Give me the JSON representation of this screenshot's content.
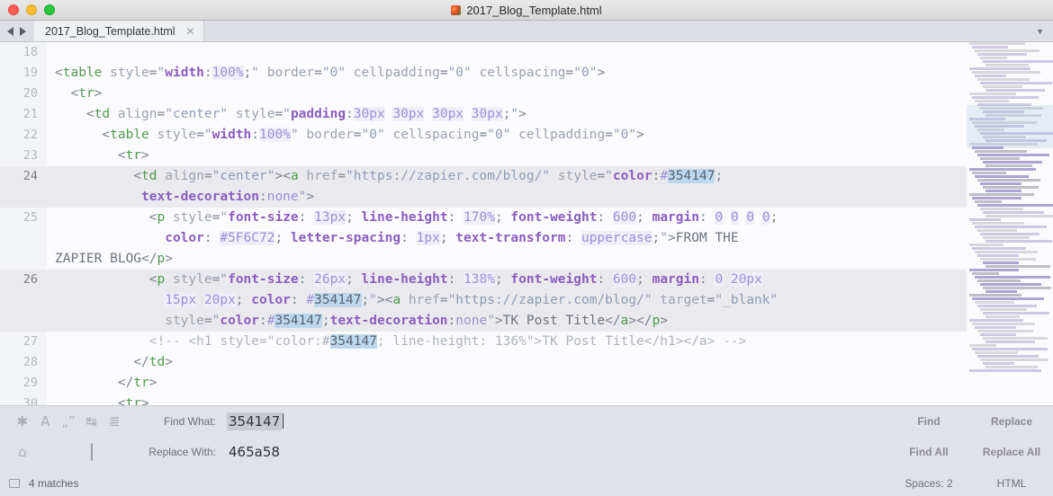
{
  "window": {
    "title": "2017_Blog_Template.html",
    "title_icon": "sublime-text-icon",
    "traffic_lights": [
      "close",
      "minimize",
      "zoom"
    ]
  },
  "tabbar": {
    "nav_back": "back-arrow",
    "nav_forward": "forward-arrow",
    "tabs": [
      {
        "label": "2017_Blog_Template.html",
        "close": "✕",
        "active": true
      }
    ],
    "menu_glyph": "▼"
  },
  "editor": {
    "lines": [
      {
        "num": "18",
        "highlight": false,
        "partial": true,
        "tokens": []
      },
      {
        "num": "19",
        "highlight": false,
        "tokens": [
          {
            "t": "punct",
            "v": "<"
          },
          {
            "t": "tag",
            "v": "table"
          },
          {
            "t": "attr",
            "v": " style"
          },
          {
            "t": "punct",
            "v": "="
          },
          {
            "t": "str",
            "v": "\""
          },
          {
            "t": "cssprop",
            "v": "width"
          },
          {
            "t": "punct",
            "v": ":"
          },
          {
            "t": "cssval",
            "v": "100%"
          },
          {
            "t": "punct",
            "v": ";"
          },
          {
            "t": "str",
            "v": "\""
          },
          {
            "t": "attr",
            "v": " border"
          },
          {
            "t": "punct",
            "v": "="
          },
          {
            "t": "str",
            "v": "\"0\""
          },
          {
            "t": "attr",
            "v": " cellpadding"
          },
          {
            "t": "punct",
            "v": "="
          },
          {
            "t": "str",
            "v": "\"0\""
          },
          {
            "t": "attr",
            "v": " cellspacing"
          },
          {
            "t": "punct",
            "v": "="
          },
          {
            "t": "str",
            "v": "\"0\""
          },
          {
            "t": "punct",
            "v": ">"
          }
        ]
      },
      {
        "num": "20",
        "highlight": false,
        "indent": 2,
        "tokens": [
          {
            "t": "punct",
            "v": "<"
          },
          {
            "t": "tag",
            "v": "tr"
          },
          {
            "t": "punct",
            "v": ">"
          }
        ]
      },
      {
        "num": "21",
        "highlight": false,
        "indent": 4,
        "tokens": [
          {
            "t": "punct",
            "v": "<"
          },
          {
            "t": "tag",
            "v": "td"
          },
          {
            "t": "attr",
            "v": " align"
          },
          {
            "t": "punct",
            "v": "="
          },
          {
            "t": "str",
            "v": "\"center\""
          },
          {
            "t": "attr",
            "v": " style"
          },
          {
            "t": "punct",
            "v": "="
          },
          {
            "t": "str",
            "v": "\""
          },
          {
            "t": "cssprop",
            "v": "padding"
          },
          {
            "t": "punct",
            "v": ":"
          },
          {
            "t": "cssval",
            "v": "30px"
          },
          {
            "t": "cssval-plain",
            "v": " "
          },
          {
            "t": "cssval",
            "v": "30px"
          },
          {
            "t": "cssval-plain",
            "v": " "
          },
          {
            "t": "cssval",
            "v": "30px"
          },
          {
            "t": "cssval-plain",
            "v": " "
          },
          {
            "t": "cssval",
            "v": "30px"
          },
          {
            "t": "punct",
            "v": ";"
          },
          {
            "t": "str",
            "v": "\""
          },
          {
            "t": "punct",
            "v": ">"
          }
        ]
      },
      {
        "num": "22",
        "highlight": false,
        "indent": 6,
        "tokens": [
          {
            "t": "punct",
            "v": "<"
          },
          {
            "t": "tag",
            "v": "table"
          },
          {
            "t": "attr",
            "v": " style"
          },
          {
            "t": "punct",
            "v": "="
          },
          {
            "t": "str",
            "v": "\""
          },
          {
            "t": "cssprop",
            "v": "width"
          },
          {
            "t": "punct",
            "v": ":"
          },
          {
            "t": "cssval",
            "v": "100%"
          },
          {
            "t": "str",
            "v": "\""
          },
          {
            "t": "attr",
            "v": " border"
          },
          {
            "t": "punct",
            "v": "="
          },
          {
            "t": "str",
            "v": "\"0\""
          },
          {
            "t": "attr",
            "v": " cellspacing"
          },
          {
            "t": "punct",
            "v": "="
          },
          {
            "t": "str",
            "v": "\"0\""
          },
          {
            "t": "attr",
            "v": " cellpadding"
          },
          {
            "t": "punct",
            "v": "="
          },
          {
            "t": "str",
            "v": "\"0\""
          },
          {
            "t": "punct",
            "v": ">"
          }
        ]
      },
      {
        "num": "23",
        "highlight": false,
        "indent": 8,
        "tokens": [
          {
            "t": "punct",
            "v": "<"
          },
          {
            "t": "tag",
            "v": "tr"
          },
          {
            "t": "punct",
            "v": ">"
          }
        ]
      },
      {
        "num": "24",
        "highlight": true,
        "indent": 10,
        "tokens": [
          {
            "t": "punct",
            "v": "<"
          },
          {
            "t": "tag",
            "v": "td"
          },
          {
            "t": "attr",
            "v": " align"
          },
          {
            "t": "punct",
            "v": "="
          },
          {
            "t": "str",
            "v": "\"center\""
          },
          {
            "t": "punct",
            "v": ">"
          },
          {
            "t": "punct",
            "v": "<"
          },
          {
            "t": "tag",
            "v": "a"
          },
          {
            "t": "attr",
            "v": " href"
          },
          {
            "t": "punct",
            "v": "="
          },
          {
            "t": "str",
            "v": "\"https://zapier.com/blog/\""
          },
          {
            "t": "attr",
            "v": " style"
          },
          {
            "t": "punct",
            "v": "="
          },
          {
            "t": "str",
            "v": "\""
          },
          {
            "t": "cssprop",
            "v": "color"
          },
          {
            "t": "punct",
            "v": ":"
          },
          {
            "t": "cssval-plain",
            "v": "#"
          },
          {
            "t": "sel",
            "v": "354147"
          },
          {
            "t": "punct",
            "v": ";"
          }
        ]
      },
      {
        "num": "",
        "highlight": true,
        "indent": 11,
        "wrap": true,
        "tokens": [
          {
            "t": "cssprop",
            "v": "text-decoration"
          },
          {
            "t": "punct",
            "v": ":"
          },
          {
            "t": "cssval-plain",
            "v": "none"
          },
          {
            "t": "str",
            "v": "\""
          },
          {
            "t": "punct",
            "v": ">"
          }
        ]
      },
      {
        "num": "25",
        "highlight": false,
        "indent": 12,
        "tokens": [
          {
            "t": "punct",
            "v": "<"
          },
          {
            "t": "tag",
            "v": "p"
          },
          {
            "t": "attr",
            "v": " style"
          },
          {
            "t": "punct",
            "v": "="
          },
          {
            "t": "str",
            "v": "\""
          },
          {
            "t": "cssprop",
            "v": "font-size"
          },
          {
            "t": "punct",
            "v": ": "
          },
          {
            "t": "cssval",
            "v": "13px"
          },
          {
            "t": "punct",
            "v": "; "
          },
          {
            "t": "cssprop",
            "v": "line-height"
          },
          {
            "t": "punct",
            "v": ": "
          },
          {
            "t": "cssval",
            "v": "170%"
          },
          {
            "t": "punct",
            "v": "; "
          },
          {
            "t": "cssprop",
            "v": "font-weight"
          },
          {
            "t": "punct",
            "v": ": "
          },
          {
            "t": "cssval",
            "v": "600"
          },
          {
            "t": "punct",
            "v": "; "
          },
          {
            "t": "cssprop",
            "v": "margin"
          },
          {
            "t": "punct",
            "v": ": "
          },
          {
            "t": "cssval",
            "v": "0"
          },
          {
            "t": "cssval-plain",
            "v": " "
          },
          {
            "t": "cssval",
            "v": "0"
          },
          {
            "t": "cssval-plain",
            "v": " "
          },
          {
            "t": "cssval",
            "v": "0"
          },
          {
            "t": "cssval-plain",
            "v": " "
          },
          {
            "t": "cssval",
            "v": "0"
          },
          {
            "t": "punct",
            "v": ";"
          }
        ]
      },
      {
        "num": "",
        "highlight": false,
        "indent": 14,
        "wrap": true,
        "tokens": [
          {
            "t": "cssprop",
            "v": "color"
          },
          {
            "t": "punct",
            "v": ": "
          },
          {
            "t": "cssval",
            "v": "#5F6C72"
          },
          {
            "t": "punct",
            "v": "; "
          },
          {
            "t": "cssprop",
            "v": "letter-spacing"
          },
          {
            "t": "punct",
            "v": ": "
          },
          {
            "t": "cssval",
            "v": "1px"
          },
          {
            "t": "punct",
            "v": "; "
          },
          {
            "t": "cssprop",
            "v": "text-transform"
          },
          {
            "t": "punct",
            "v": ": "
          },
          {
            "t": "cssval",
            "v": "uppercase"
          },
          {
            "t": "punct",
            "v": ";"
          },
          {
            "t": "str",
            "v": "\""
          },
          {
            "t": "punct",
            "v": ">"
          },
          {
            "t": "txt",
            "v": "FROM THE"
          }
        ]
      },
      {
        "num": "",
        "highlight": false,
        "indent": 0,
        "wrap": true,
        "tokens": [
          {
            "t": "txt",
            "v": "ZAPIER BLOG"
          },
          {
            "t": "punct",
            "v": "</"
          },
          {
            "t": "tag",
            "v": "p"
          },
          {
            "t": "punct",
            "v": ">"
          }
        ]
      },
      {
        "num": "26",
        "highlight": true,
        "indent": 12,
        "tokens": [
          {
            "t": "punct",
            "v": "<"
          },
          {
            "t": "tag",
            "v": "p"
          },
          {
            "t": "attr",
            "v": " style"
          },
          {
            "t": "punct",
            "v": "="
          },
          {
            "t": "str",
            "v": "\""
          },
          {
            "t": "cssprop",
            "v": "font-size"
          },
          {
            "t": "punct",
            "v": ": "
          },
          {
            "t": "cssval",
            "v": "26px"
          },
          {
            "t": "punct",
            "v": "; "
          },
          {
            "t": "cssprop",
            "v": "line-height"
          },
          {
            "t": "punct",
            "v": ": "
          },
          {
            "t": "cssval",
            "v": "138%"
          },
          {
            "t": "punct",
            "v": "; "
          },
          {
            "t": "cssprop",
            "v": "font-weight"
          },
          {
            "t": "punct",
            "v": ": "
          },
          {
            "t": "cssval",
            "v": "600"
          },
          {
            "t": "punct",
            "v": "; "
          },
          {
            "t": "cssprop",
            "v": "margin"
          },
          {
            "t": "punct",
            "v": ": "
          },
          {
            "t": "cssval",
            "v": "0"
          },
          {
            "t": "cssval-plain",
            "v": " "
          },
          {
            "t": "cssval",
            "v": "20px"
          }
        ]
      },
      {
        "num": "",
        "highlight": true,
        "indent": 14,
        "wrap": true,
        "tokens": [
          {
            "t": "cssval",
            "v": "15px"
          },
          {
            "t": "cssval-plain",
            "v": " "
          },
          {
            "t": "cssval",
            "v": "20px"
          },
          {
            "t": "punct",
            "v": "; "
          },
          {
            "t": "cssprop",
            "v": "color"
          },
          {
            "t": "punct",
            "v": ": "
          },
          {
            "t": "cssval-plain",
            "v": "#"
          },
          {
            "t": "sel",
            "v": "354147"
          },
          {
            "t": "punct",
            "v": ";"
          },
          {
            "t": "str",
            "v": "\""
          },
          {
            "t": "punct",
            "v": ">"
          },
          {
            "t": "punct",
            "v": "<"
          },
          {
            "t": "tag",
            "v": "a"
          },
          {
            "t": "attr",
            "v": " href"
          },
          {
            "t": "punct",
            "v": "="
          },
          {
            "t": "str",
            "v": "\"https://zapier.com/blog/\""
          },
          {
            "t": "attr",
            "v": " target"
          },
          {
            "t": "punct",
            "v": "="
          },
          {
            "t": "str",
            "v": "\"_blank\""
          }
        ]
      },
      {
        "num": "",
        "highlight": true,
        "indent": 14,
        "wrap": true,
        "tokens": [
          {
            "t": "attr",
            "v": "style"
          },
          {
            "t": "punct",
            "v": "="
          },
          {
            "t": "str",
            "v": "\""
          },
          {
            "t": "cssprop",
            "v": "color"
          },
          {
            "t": "punct",
            "v": ":"
          },
          {
            "t": "cssval-plain",
            "v": "#"
          },
          {
            "t": "sel",
            "v": "354147"
          },
          {
            "t": "punct",
            "v": ";"
          },
          {
            "t": "cssprop",
            "v": "text-decoration"
          },
          {
            "t": "punct",
            "v": ":"
          },
          {
            "t": "cssval-plain",
            "v": "none"
          },
          {
            "t": "str",
            "v": "\""
          },
          {
            "t": "punct",
            "v": ">"
          },
          {
            "t": "txt",
            "v": "TK Post Title"
          },
          {
            "t": "punct",
            "v": "</"
          },
          {
            "t": "tag",
            "v": "a"
          },
          {
            "t": "punct",
            "v": ">"
          },
          {
            "t": "punct",
            "v": "</"
          },
          {
            "t": "tag",
            "v": "p"
          },
          {
            "t": "punct",
            "v": ">"
          }
        ]
      },
      {
        "num": "27",
        "highlight": false,
        "indent": 12,
        "tokens": [
          {
            "t": "comment",
            "v": "<!-- <h1 style=\"color:#"
          },
          {
            "t": "sel",
            "v": "354147"
          },
          {
            "t": "comment",
            "v": "; line-height: 136%\">TK Post Title</h1></a> -->"
          }
        ]
      },
      {
        "num": "28",
        "highlight": false,
        "indent": 10,
        "tokens": [
          {
            "t": "punct",
            "v": "</"
          },
          {
            "t": "tag",
            "v": "td"
          },
          {
            "t": "punct",
            "v": ">"
          }
        ]
      },
      {
        "num": "29",
        "highlight": false,
        "indent": 8,
        "tokens": [
          {
            "t": "punct",
            "v": "</"
          },
          {
            "t": "tag",
            "v": "tr"
          },
          {
            "t": "punct",
            "v": ">"
          }
        ]
      },
      {
        "num": "30",
        "highlight": false,
        "indent": 8,
        "tokens": [
          {
            "t": "punct",
            "v": "<"
          },
          {
            "t": "tag",
            "v": "tr"
          },
          {
            "t": "punct",
            "v": ">"
          }
        ]
      }
    ]
  },
  "find_panel": {
    "toggles_row1": [
      {
        "name": "regex-toggle",
        "glyph": "✱"
      },
      {
        "name": "case-sensitive-toggle",
        "glyph": "A"
      },
      {
        "name": "whole-word-toggle",
        "glyph": "„”"
      },
      {
        "name": "wrap-toggle",
        "glyph": "↹"
      },
      {
        "name": "in-selection-toggle",
        "glyph": "≣"
      }
    ],
    "toggles_row2": [
      {
        "name": "preserve-case-toggle",
        "glyph": "⌂"
      },
      {
        "name": "highlight-matches-checkbox",
        "glyph": "checkbox"
      }
    ],
    "find_label": "Find What:",
    "find_value": "354147",
    "replace_label": "Replace With:",
    "replace_value": "465a58",
    "buttons": {
      "find": "Find",
      "replace": "Replace",
      "find_all": "Find All",
      "replace_all": "Replace All"
    }
  },
  "status_bar": {
    "panel_icon": "panel-toggle-icon",
    "matches": "4 matches",
    "indent": "Spaces: 2",
    "syntax": "HTML"
  },
  "colors": {
    "selection_highlight": "#bdd8ee",
    "find_field_selection": "#c7cbd1",
    "tag": "#4f9a4f",
    "css_property": "#8a5fbf",
    "css_value": "#9b8fd6",
    "string": "#8e9bb5",
    "comment": "#aeb3bb"
  }
}
